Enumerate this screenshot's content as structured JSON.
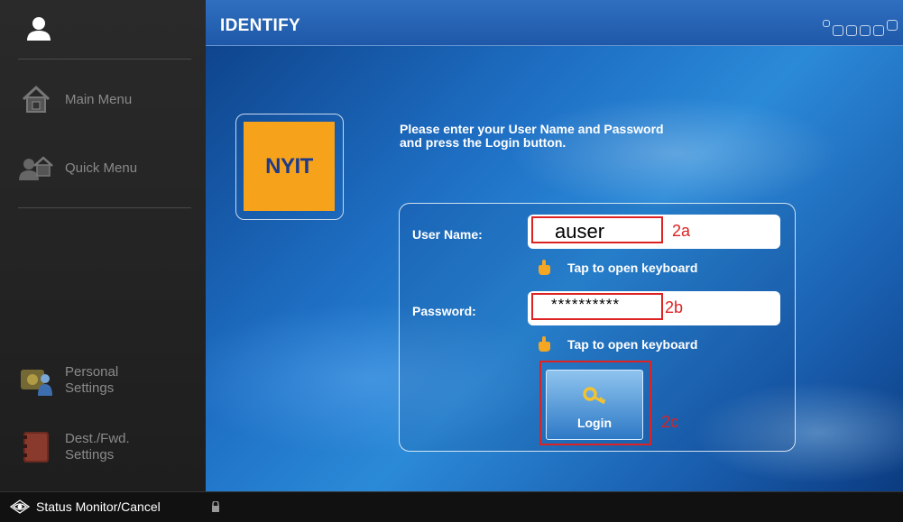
{
  "sidebar": {
    "user_icon": "user-icon",
    "items": [
      {
        "label": "Main Menu",
        "icon": "home-icon"
      },
      {
        "label": "Quick Menu",
        "icon": "quick-menu-icon"
      }
    ],
    "bottom_items": [
      {
        "label_line1": "Personal",
        "label_line2": "Settings",
        "icon": "personal-settings-icon"
      },
      {
        "label_line1": "Dest./Fwd.",
        "label_line2": "Settings",
        "icon": "address-book-icon"
      }
    ]
  },
  "header": {
    "title": "IDENTIFY"
  },
  "logo": {
    "text": "NYIT"
  },
  "instructions": {
    "line1": "Please enter your User Name and Password",
    "line2": "and press the Login button."
  },
  "form": {
    "username": {
      "label": "User Name:",
      "value": "auser",
      "annotation": "2a"
    },
    "password": {
      "label": "Password:",
      "value": "**********",
      "annotation": "2b"
    },
    "keyboard_hint": "Tap to open keyboard",
    "login": {
      "label": "Login",
      "annotation": "2c"
    }
  },
  "footer": {
    "status_label": "Status Monitor/Cancel"
  },
  "colors": {
    "accent": "#1f58a8",
    "logo_bg": "#f6a21b",
    "annotation": "#dd2222"
  }
}
